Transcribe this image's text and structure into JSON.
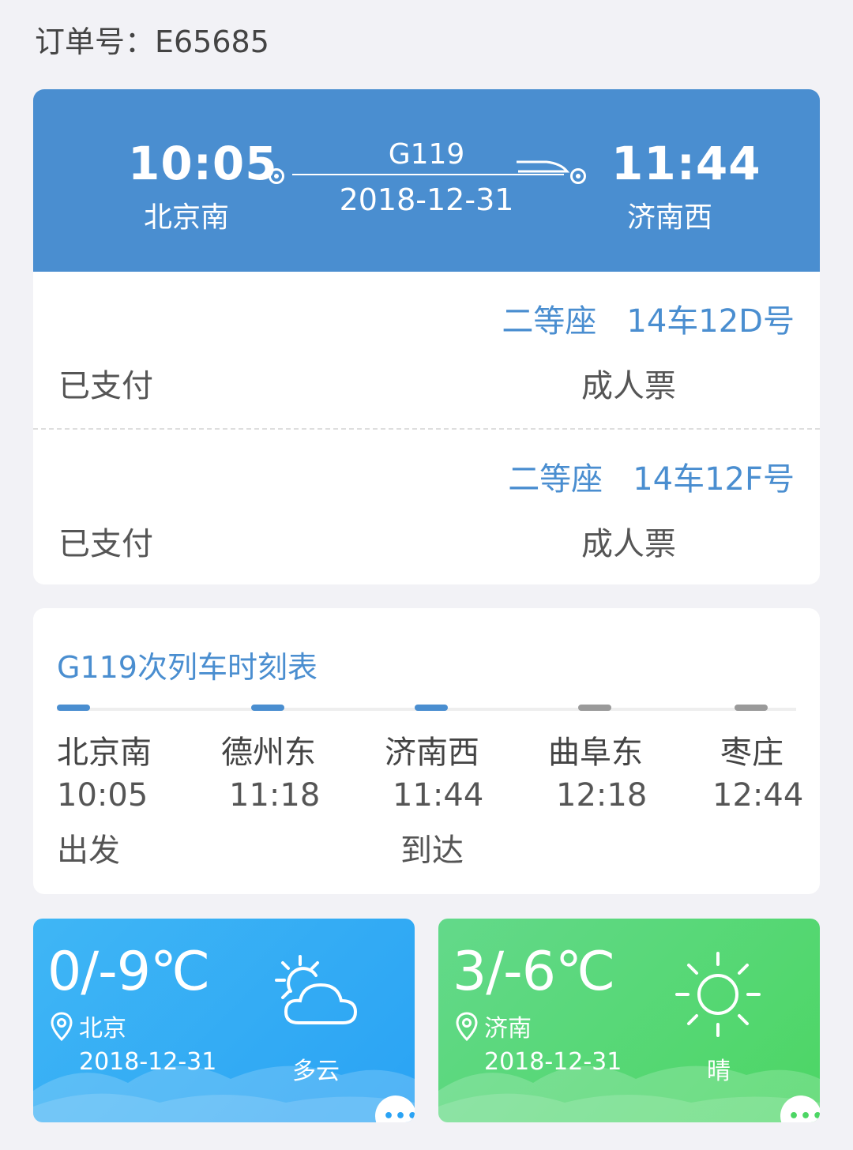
{
  "order": {
    "label": "订单号：E65685"
  },
  "trip": {
    "departure_time": "10:05",
    "departure_station": "北京南",
    "arrival_time": "11:44",
    "arrival_station": "济南西",
    "train_no": "G119",
    "date": "2018-12-31"
  },
  "passengers": [
    {
      "seat_class": "二等座",
      "seat_no": "14车12D号",
      "status": "已支付",
      "ticket_type": "成人票"
    },
    {
      "seat_class": "二等座",
      "seat_no": "14车12F号",
      "status": "已支付",
      "ticket_type": "成人票"
    }
  ],
  "timetable": {
    "title": "G119次列车时刻表",
    "stops": [
      {
        "name": "北京南",
        "time": "10:05",
        "note": "出发",
        "state": "passed"
      },
      {
        "name": "德州东",
        "time": "11:18",
        "note": "",
        "state": "passed"
      },
      {
        "name": "济南西",
        "time": "11:44",
        "note": "到达",
        "state": "passed"
      },
      {
        "name": "曲阜东",
        "time": "12:18",
        "note": "",
        "state": "future"
      },
      {
        "name": "枣庄",
        "time": "12:44",
        "note": "",
        "state": "future"
      }
    ]
  },
  "weather": [
    {
      "temp": "0/-9℃",
      "city": "北京",
      "date": "2018-12-31",
      "condition": "多云",
      "icon": "partly-cloudy-icon",
      "color": "#2aa3f4"
    },
    {
      "temp": "3/-6℃",
      "city": "济南",
      "date": "2018-12-31",
      "condition": "晴",
      "icon": "sunny-icon",
      "color": "#4cd664"
    }
  ],
  "colors": {
    "accent": "#4a8ed0",
    "background": "#f2f2f6"
  }
}
